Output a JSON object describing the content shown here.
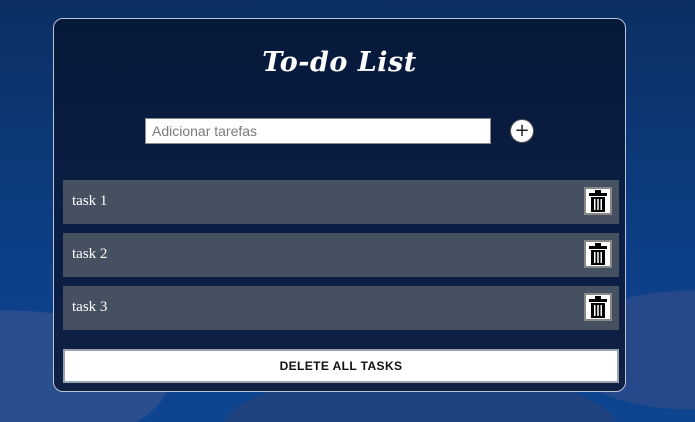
{
  "app": {
    "title": "To-do List"
  },
  "input": {
    "placeholder": "Adicionar tarefas",
    "value": "",
    "add_icon": "plus-icon"
  },
  "tasks": [
    {
      "label": "task 1",
      "delete_icon": "trash-icon"
    },
    {
      "label": "task 2",
      "delete_icon": "trash-icon"
    },
    {
      "label": "task 3",
      "delete_icon": "trash-icon"
    }
  ],
  "actions": {
    "delete_all_label": "DELETE ALL TASKS"
  },
  "colors": {
    "card_background": "#07193a",
    "task_row": "#455061",
    "page_background": "#0a3a7a"
  }
}
